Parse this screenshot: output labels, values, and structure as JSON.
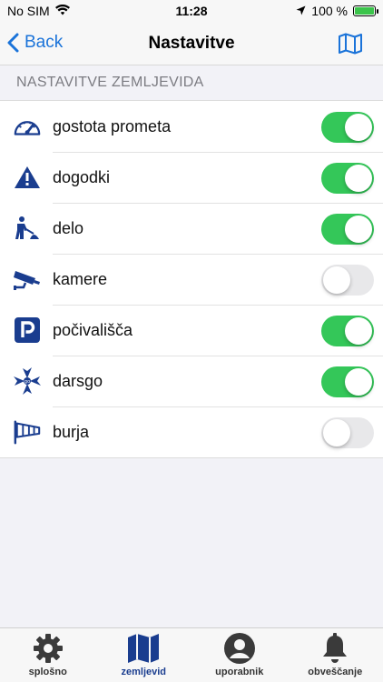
{
  "status_bar": {
    "carrier": "No SIM",
    "time": "11:28",
    "battery": "100 %"
  },
  "nav": {
    "back_label": "Back",
    "title": "Nastavitve",
    "right_icon": "map-icon"
  },
  "section": {
    "header": "NASTAVITVE ZEMLJEVIDA"
  },
  "settings": [
    {
      "label": "gostota prometa",
      "icon": "gauge-icon",
      "enabled": true
    },
    {
      "label": "dogodki",
      "icon": "warning-icon",
      "enabled": true
    },
    {
      "label": "delo",
      "icon": "roadwork-icon",
      "enabled": true
    },
    {
      "label": "kamere",
      "icon": "camera-icon",
      "enabled": false
    },
    {
      "label": "počivališča",
      "icon": "parking-icon",
      "enabled": true
    },
    {
      "label": "darsgo",
      "icon": "darsgo-icon",
      "enabled": true
    },
    {
      "label": "burja",
      "icon": "windsock-icon",
      "enabled": false
    }
  ],
  "tabs": [
    {
      "label": "splošno",
      "icon": "gear-icon",
      "active": false
    },
    {
      "label": "zemljevid",
      "icon": "map-icon",
      "active": true
    },
    {
      "label": "uporabnik",
      "icon": "user-icon",
      "active": false
    },
    {
      "label": "obveščanje",
      "icon": "bell-icon",
      "active": false
    }
  ],
  "colors": {
    "accent": "#1a73d9",
    "toggle_on": "#34c759",
    "icon_blue": "#1a3d8f"
  }
}
